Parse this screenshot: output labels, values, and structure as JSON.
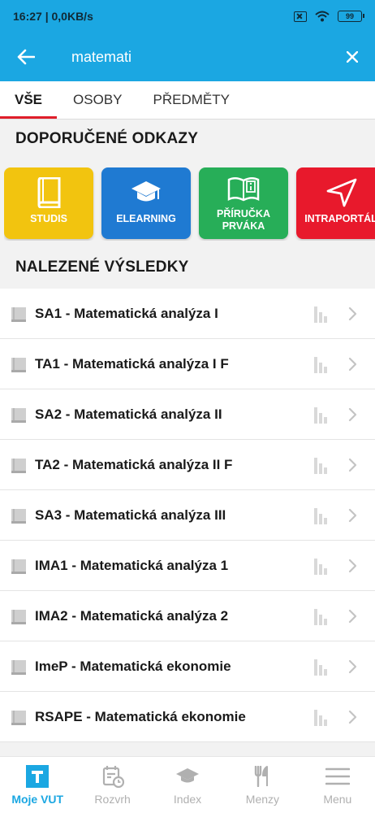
{
  "status_bar": {
    "time": "16:27 | 0,0KB/s",
    "battery": "99"
  },
  "search": {
    "query": "matemati",
    "back_icon": "arrow-left-icon",
    "clear_icon": "close-icon"
  },
  "tabs": [
    {
      "label": "VŠE",
      "active": true
    },
    {
      "label": "OSOBY",
      "active": false
    },
    {
      "label": "PŘEDMĚTY",
      "active": false
    }
  ],
  "recommended": {
    "title": "DOPORUČENÉ ODKAZY",
    "tiles": [
      {
        "label": "STUDIS",
        "color": "#f2c40f",
        "icon": "book-icon"
      },
      {
        "label": "ELEARNING",
        "color": "#1f7ad2",
        "icon": "graduation-cap-icon"
      },
      {
        "label": "PŘÍRUČKA\nPRVÁKA",
        "line1": "PŘÍRUČKA",
        "line2": "PRVÁKA",
        "color": "#27ae58",
        "icon": "info-book-icon"
      },
      {
        "label": "INTRAPORTÁL",
        "color": "#e8192c",
        "icon": "navigation-arrow-icon"
      }
    ]
  },
  "results": {
    "title": "NALEZENÉ VÝSLEDKY",
    "items": [
      "SA1 - Matematická analýza I",
      "TA1 - Matematická analýza I F",
      "SA2 - Matematická analýza II",
      "TA2 - Matematická analýza II F",
      "SA3 - Matematická analýza III",
      "IMA1 - Matematická analýza 1",
      "IMA2 - Matematická analýza 2",
      "ImeP - Matematická ekonomie",
      "RSAPE - Matematická ekonomie"
    ]
  },
  "bottom_nav": [
    {
      "label": "Moje VUT",
      "icon": "vut-logo-icon",
      "active": true
    },
    {
      "label": "Rozvrh",
      "icon": "calendar-clock-icon",
      "active": false
    },
    {
      "label": "Index",
      "icon": "graduation-cap-icon",
      "active": false
    },
    {
      "label": "Menzy",
      "icon": "fork-knife-icon",
      "active": false
    },
    {
      "label": "Menu",
      "icon": "hamburger-menu-icon",
      "active": false
    }
  ],
  "colors": {
    "accent": "#1ba7e2",
    "tab_indicator": "#e01e2a"
  }
}
